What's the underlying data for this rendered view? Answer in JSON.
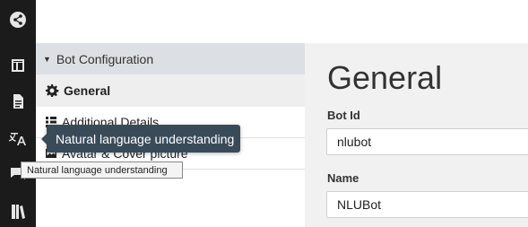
{
  "rail": {
    "items": [
      {
        "icon": "share-icon"
      },
      {
        "icon": "layout-icon"
      },
      {
        "icon": "document-icon"
      },
      {
        "icon": "translate-icon"
      },
      {
        "icon": "chat-icon"
      },
      {
        "icon": "book-icon"
      }
    ]
  },
  "sidebar": {
    "section_title": "Bot Configuration",
    "items": [
      {
        "label": "General",
        "icon": "gear-icon",
        "active": true
      },
      {
        "label": "Additional Details",
        "icon": "list-icon"
      },
      {
        "label": "Avatar & Cover picture",
        "icon": "image-icon"
      }
    ]
  },
  "main": {
    "title": "General",
    "fields": [
      {
        "label": "Bot Id",
        "value": "nlubot"
      },
      {
        "label": "Name",
        "value": "NLUBot"
      }
    ]
  },
  "tooltip": {
    "text": "Natural language understanding",
    "native_text": "Natural language understanding"
  },
  "colors": {
    "rail_bg": "#1b1b1b",
    "sidebar_header_bg": "#dcdfe3",
    "main_bg": "#f1f1f1",
    "tooltip_bg": "#394b59"
  }
}
